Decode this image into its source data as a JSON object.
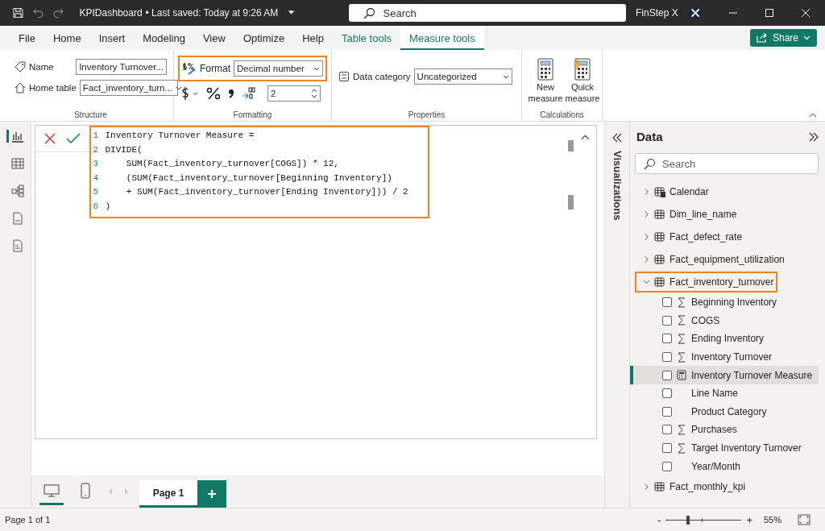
{
  "window": {
    "file_name": "KPIDashboard",
    "saved": "• Last saved: Today at 9:26 AM",
    "search_placeholder": "Search",
    "user": "FinStep X"
  },
  "menu_tabs": [
    {
      "label": "File",
      "selected": false,
      "contextual": false
    },
    {
      "label": "Home",
      "selected": false,
      "contextual": false
    },
    {
      "label": "Insert",
      "selected": false,
      "contextual": false
    },
    {
      "label": "Modeling",
      "selected": false,
      "contextual": false
    },
    {
      "label": "View",
      "selected": false,
      "contextual": false
    },
    {
      "label": "Optimize",
      "selected": false,
      "contextual": false
    },
    {
      "label": "Help",
      "selected": false,
      "contextual": false
    },
    {
      "label": "Table tools",
      "selected": false,
      "contextual": true
    },
    {
      "label": "Measure tools",
      "selected": true,
      "contextual": true
    }
  ],
  "share_button": "Share",
  "ribbon": {
    "structure": {
      "label": "Structure",
      "name_label": "Name",
      "name_value": "Inventory Turnover...",
      "home_table_label": "Home table",
      "home_table_value": "Fact_inventory_turn..."
    },
    "formatting": {
      "label": "Formatting",
      "format_label": "Format",
      "format_value": "Decimal number",
      "highlighted": true,
      "decimals": "2"
    },
    "properties": {
      "label": "Properties",
      "data_category_label": "Data category",
      "data_category_value": "Uncategorized"
    },
    "calculations": {
      "label": "Calculations",
      "buttons": [
        "New measure",
        "Quick measure"
      ]
    }
  },
  "formula": {
    "highlighted": true,
    "lines": [
      {
        "number": "1",
        "text": "Inventory Turnover Measure ="
      },
      {
        "number": "2",
        "text": "DIVIDE("
      },
      {
        "number": "3",
        "text": "    SUM(Fact_inventory_turnover[COGS]) * 12,"
      },
      {
        "number": "4",
        "text": "    (SUM(Fact_inventory_turnover[Beginning Inventory])"
      },
      {
        "number": "5",
        "text": "    + SUM(Fact_inventory_turnover[Ending Inventory])) / 2"
      },
      {
        "number": "6",
        "text": ")"
      }
    ]
  },
  "visualizations_label": "Visualizations",
  "data_pane": {
    "title": "Data",
    "search_placeholder": "Search",
    "tables": [
      {
        "name": "Calendar",
        "kind": "calendar",
        "expanded": false,
        "highlighted": false
      },
      {
        "name": "Dim_line_name",
        "kind": "table",
        "expanded": false,
        "highlighted": false
      },
      {
        "name": "Fact_defect_rate",
        "kind": "table",
        "expanded": false,
        "highlighted": false
      },
      {
        "name": "Fact_equipment_utilization",
        "kind": "table",
        "expanded": false,
        "highlighted": false
      },
      {
        "name": "Fact_inventory_turnover",
        "kind": "table",
        "expanded": true,
        "highlighted": true,
        "children": [
          {
            "name": "Beginning Inventory",
            "kind": "sum",
            "checked": false,
            "selected": false
          },
          {
            "name": "COGS",
            "kind": "sum",
            "checked": false,
            "selected": false
          },
          {
            "name": "Ending Inventory",
            "kind": "sum",
            "checked": false,
            "selected": false
          },
          {
            "name": "Inventory Turnover",
            "kind": "sum",
            "checked": false,
            "selected": false
          },
          {
            "name": "Inventory Turnover Measure",
            "kind": "measure",
            "checked": false,
            "selected": true
          },
          {
            "name": "Line Name",
            "kind": "text",
            "checked": false,
            "selected": false
          },
          {
            "name": "Product Category",
            "kind": "text",
            "checked": false,
            "selected": false
          },
          {
            "name": "Purchases",
            "kind": "sum",
            "checked": false,
            "selected": false
          },
          {
            "name": "Target Inventory Turnover",
            "kind": "sum",
            "checked": false,
            "selected": false
          },
          {
            "name": "Year/Month",
            "kind": "text",
            "checked": false,
            "selected": false
          }
        ]
      },
      {
        "name": "Fact_monthly_kpi",
        "kind": "table",
        "expanded": false,
        "highlighted": false
      }
    ]
  },
  "pages": [
    {
      "label": "Page 1",
      "selected": true
    }
  ],
  "view_buttons": [
    {
      "kind": "desktop",
      "selected": true
    },
    {
      "kind": "mobile",
      "selected": false
    }
  ],
  "status_bar": {
    "page_info": "Page 1 of 1",
    "zoom": {
      "out_label": "-",
      "in_label": "+",
      "level": 0.27,
      "reading": "55%"
    }
  }
}
